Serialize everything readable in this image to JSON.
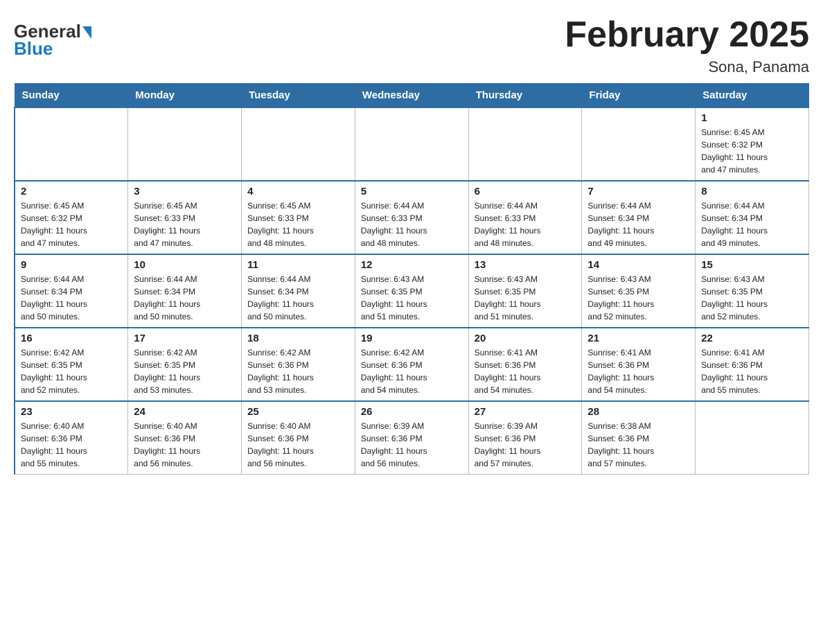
{
  "header": {
    "title": "February 2025",
    "subtitle": "Sona, Panama",
    "logo_general": "General",
    "logo_blue": "Blue"
  },
  "days_of_week": [
    "Sunday",
    "Monday",
    "Tuesday",
    "Wednesday",
    "Thursday",
    "Friday",
    "Saturday"
  ],
  "weeks": [
    {
      "days": [
        {
          "number": "",
          "info": ""
        },
        {
          "number": "",
          "info": ""
        },
        {
          "number": "",
          "info": ""
        },
        {
          "number": "",
          "info": ""
        },
        {
          "number": "",
          "info": ""
        },
        {
          "number": "",
          "info": ""
        },
        {
          "number": "1",
          "info": "Sunrise: 6:45 AM\nSunset: 6:32 PM\nDaylight: 11 hours\nand 47 minutes."
        }
      ]
    },
    {
      "days": [
        {
          "number": "2",
          "info": "Sunrise: 6:45 AM\nSunset: 6:32 PM\nDaylight: 11 hours\nand 47 minutes."
        },
        {
          "number": "3",
          "info": "Sunrise: 6:45 AM\nSunset: 6:33 PM\nDaylight: 11 hours\nand 47 minutes."
        },
        {
          "number": "4",
          "info": "Sunrise: 6:45 AM\nSunset: 6:33 PM\nDaylight: 11 hours\nand 48 minutes."
        },
        {
          "number": "5",
          "info": "Sunrise: 6:44 AM\nSunset: 6:33 PM\nDaylight: 11 hours\nand 48 minutes."
        },
        {
          "number": "6",
          "info": "Sunrise: 6:44 AM\nSunset: 6:33 PM\nDaylight: 11 hours\nand 48 minutes."
        },
        {
          "number": "7",
          "info": "Sunrise: 6:44 AM\nSunset: 6:34 PM\nDaylight: 11 hours\nand 49 minutes."
        },
        {
          "number": "8",
          "info": "Sunrise: 6:44 AM\nSunset: 6:34 PM\nDaylight: 11 hours\nand 49 minutes."
        }
      ]
    },
    {
      "days": [
        {
          "number": "9",
          "info": "Sunrise: 6:44 AM\nSunset: 6:34 PM\nDaylight: 11 hours\nand 50 minutes."
        },
        {
          "number": "10",
          "info": "Sunrise: 6:44 AM\nSunset: 6:34 PM\nDaylight: 11 hours\nand 50 minutes."
        },
        {
          "number": "11",
          "info": "Sunrise: 6:44 AM\nSunset: 6:34 PM\nDaylight: 11 hours\nand 50 minutes."
        },
        {
          "number": "12",
          "info": "Sunrise: 6:43 AM\nSunset: 6:35 PM\nDaylight: 11 hours\nand 51 minutes."
        },
        {
          "number": "13",
          "info": "Sunrise: 6:43 AM\nSunset: 6:35 PM\nDaylight: 11 hours\nand 51 minutes."
        },
        {
          "number": "14",
          "info": "Sunrise: 6:43 AM\nSunset: 6:35 PM\nDaylight: 11 hours\nand 52 minutes."
        },
        {
          "number": "15",
          "info": "Sunrise: 6:43 AM\nSunset: 6:35 PM\nDaylight: 11 hours\nand 52 minutes."
        }
      ]
    },
    {
      "days": [
        {
          "number": "16",
          "info": "Sunrise: 6:42 AM\nSunset: 6:35 PM\nDaylight: 11 hours\nand 52 minutes."
        },
        {
          "number": "17",
          "info": "Sunrise: 6:42 AM\nSunset: 6:35 PM\nDaylight: 11 hours\nand 53 minutes."
        },
        {
          "number": "18",
          "info": "Sunrise: 6:42 AM\nSunset: 6:36 PM\nDaylight: 11 hours\nand 53 minutes."
        },
        {
          "number": "19",
          "info": "Sunrise: 6:42 AM\nSunset: 6:36 PM\nDaylight: 11 hours\nand 54 minutes."
        },
        {
          "number": "20",
          "info": "Sunrise: 6:41 AM\nSunset: 6:36 PM\nDaylight: 11 hours\nand 54 minutes."
        },
        {
          "number": "21",
          "info": "Sunrise: 6:41 AM\nSunset: 6:36 PM\nDaylight: 11 hours\nand 54 minutes."
        },
        {
          "number": "22",
          "info": "Sunrise: 6:41 AM\nSunset: 6:36 PM\nDaylight: 11 hours\nand 55 minutes."
        }
      ]
    },
    {
      "days": [
        {
          "number": "23",
          "info": "Sunrise: 6:40 AM\nSunset: 6:36 PM\nDaylight: 11 hours\nand 55 minutes."
        },
        {
          "number": "24",
          "info": "Sunrise: 6:40 AM\nSunset: 6:36 PM\nDaylight: 11 hours\nand 56 minutes."
        },
        {
          "number": "25",
          "info": "Sunrise: 6:40 AM\nSunset: 6:36 PM\nDaylight: 11 hours\nand 56 minutes."
        },
        {
          "number": "26",
          "info": "Sunrise: 6:39 AM\nSunset: 6:36 PM\nDaylight: 11 hours\nand 56 minutes."
        },
        {
          "number": "27",
          "info": "Sunrise: 6:39 AM\nSunset: 6:36 PM\nDaylight: 11 hours\nand 57 minutes."
        },
        {
          "number": "28",
          "info": "Sunrise: 6:38 AM\nSunset: 6:36 PM\nDaylight: 11 hours\nand 57 minutes."
        },
        {
          "number": "",
          "info": ""
        }
      ]
    }
  ]
}
